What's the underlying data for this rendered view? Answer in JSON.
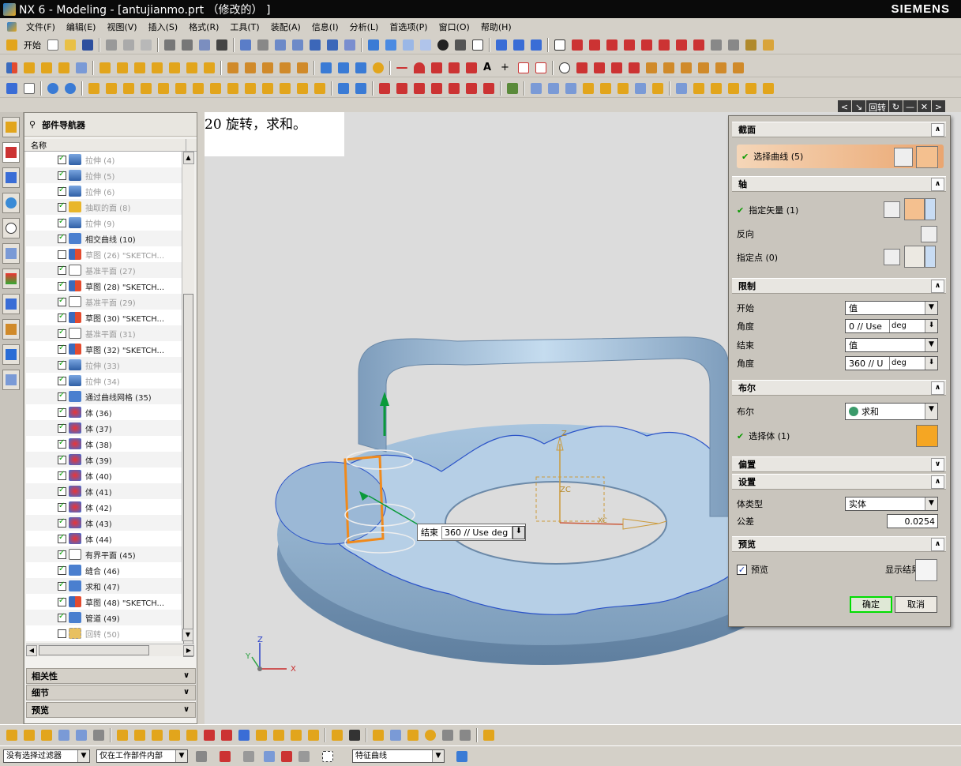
{
  "titlebar": {
    "title": "NX 6 - Modeling - [antujianmo.prt （修改的） ]",
    "brand": "SIEMENS"
  },
  "menu": [
    "开始",
    "文件(F)",
    "编辑(E)",
    "视图(V)",
    "插入(S)",
    "格式(R)",
    "工具(T)",
    "装配(A)",
    "信息(I)",
    "分析(L)",
    "首选项(P)",
    "窗口(O)",
    "帮助(H)"
  ],
  "dialog_titlebar": {
    "title": "回转"
  },
  "part_navigator": {
    "title": "部件导航器",
    "column_name": "名称",
    "items": [
      {
        "label": "拉伸 (4)",
        "checked": true,
        "icon": "extrude",
        "dim": true
      },
      {
        "label": "拉伸 (5)",
        "checked": true,
        "icon": "extrude",
        "dim": true
      },
      {
        "label": "拉伸 (6)",
        "checked": true,
        "icon": "extrude",
        "dim": true
      },
      {
        "label": "抽取的面 (8)",
        "checked": true,
        "icon": "face",
        "dim": true
      },
      {
        "label": "拉伸 (9)",
        "checked": true,
        "icon": "extrude",
        "dim": true
      },
      {
        "label": "相交曲线 (10)",
        "checked": true,
        "icon": "misc",
        "dim": false
      },
      {
        "label": "草图 (26) \"SKETCH...",
        "checked": false,
        "icon": "sketch",
        "dim": true
      },
      {
        "label": "基准平面 (27)",
        "checked": true,
        "icon": "plane",
        "dim": true
      },
      {
        "label": "草图 (28) \"SKETCH...",
        "checked": true,
        "icon": "sketch",
        "dim": false
      },
      {
        "label": "基准平面 (29)",
        "checked": true,
        "icon": "plane",
        "dim": true
      },
      {
        "label": "草图 (30) \"SKETCH...",
        "checked": true,
        "icon": "sketch",
        "dim": false
      },
      {
        "label": "基准平面 (31)",
        "checked": true,
        "icon": "plane",
        "dim": true
      },
      {
        "label": "草图 (32) \"SKETCH...",
        "checked": true,
        "icon": "sketch",
        "dim": false
      },
      {
        "label": "拉伸 (33)",
        "checked": true,
        "icon": "extrude",
        "dim": true
      },
      {
        "label": "拉伸 (34)",
        "checked": true,
        "icon": "extrude",
        "dim": true
      },
      {
        "label": "通过曲线网格 (35)",
        "checked": true,
        "icon": "misc",
        "dim": false
      },
      {
        "label": "体 (36)",
        "checked": true,
        "icon": "body",
        "dim": false
      },
      {
        "label": "体 (37)",
        "checked": true,
        "icon": "body",
        "dim": false
      },
      {
        "label": "体 (38)",
        "checked": true,
        "icon": "body",
        "dim": false
      },
      {
        "label": "体 (39)",
        "checked": true,
        "icon": "body",
        "dim": false
      },
      {
        "label": "体 (40)",
        "checked": true,
        "icon": "body",
        "dim": false
      },
      {
        "label": "体 (41)",
        "checked": true,
        "icon": "body",
        "dim": false
      },
      {
        "label": "体 (42)",
        "checked": true,
        "icon": "body",
        "dim": false
      },
      {
        "label": "体 (43)",
        "checked": true,
        "icon": "body",
        "dim": false
      },
      {
        "label": "体 (44)",
        "checked": true,
        "icon": "body",
        "dim": false
      },
      {
        "label": "有界平面 (45)",
        "checked": true,
        "icon": "plane",
        "dim": false
      },
      {
        "label": "缝合 (46)",
        "checked": true,
        "icon": "misc",
        "dim": false
      },
      {
        "label": "求和 (47)",
        "checked": true,
        "icon": "misc",
        "dim": false
      },
      {
        "label": "草图 (48) \"SKETCH...",
        "checked": true,
        "icon": "sketch",
        "dim": false
      },
      {
        "label": "管道 (49)",
        "checked": true,
        "icon": "misc",
        "dim": false
      },
      {
        "label": "回转 (50)",
        "checked": false,
        "icon": "revolve",
        "dim": true
      }
    ],
    "panels": [
      "相关性",
      "细节",
      "预览"
    ]
  },
  "viewport": {
    "cue_text": "20 旋转，求和。",
    "onscreen_label": "结束",
    "onscreen_value": "360 // Use deg",
    "triad_labels": {
      "x": "X",
      "y": "Y",
      "z": "Z"
    },
    "csys_labels": {
      "z": "Z",
      "zc": "ZC",
      "xc": "XC"
    }
  },
  "dialog": {
    "sections": {
      "section": "截面",
      "axis": "轴",
      "limits": "限制",
      "boolean": "布尔",
      "offset": "偏置",
      "settings": "设置",
      "preview": "预览"
    },
    "select_curve": "选择曲线 (5)",
    "specify_vector": "指定矢量 (1)",
    "reverse": "反向",
    "specify_point": "指定点 (0)",
    "start_label": "开始",
    "start_value": "值",
    "angle1_label": "角度",
    "angle1_value": "0 // Use",
    "angle1_unit": "deg",
    "end_label": "结束",
    "end_value": "值",
    "angle2_label": "角度",
    "angle2_value": "360 // U",
    "angle2_unit": "deg",
    "bool_label": "布尔",
    "bool_value": "求和",
    "select_body": "选择体 (1)",
    "body_type_label": "体类型",
    "body_type_value": "实体",
    "tolerance_label": "公差",
    "tolerance_value": "0.0254",
    "preview_checkbox": "预览",
    "preview_checked": true,
    "show_result": "显示结果",
    "ok": "确定",
    "cancel": "取消"
  },
  "statusbar": {
    "filter": "没有选择过滤器",
    "scope": "仅在工作部件内部",
    "curve_rule": "特征曲线"
  }
}
